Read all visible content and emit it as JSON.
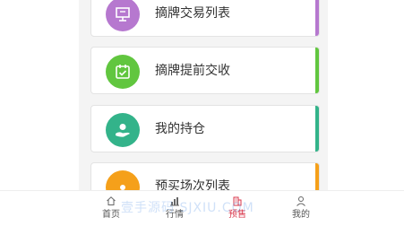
{
  "cards": [
    {
      "label": "摘牌交易列表",
      "icon": "presentation-board-icon",
      "color": "#b678cf",
      "stripe_color": "#b678cf"
    },
    {
      "label": "摘牌提前交收",
      "icon": "calendar-check-icon",
      "color": "#61c63f",
      "stripe_color": "#61c63f"
    },
    {
      "label": "我的持仓",
      "icon": "hand-coin-icon",
      "color": "#33b38a",
      "stripe_color": "#33b38a"
    },
    {
      "label": "预买场次列表",
      "icon": "list-icon",
      "color": "#f5a01a",
      "stripe_color": "#f5a01a"
    }
  ],
  "tabbar": {
    "tabs": [
      {
        "label": "首页",
        "icon": "home-icon",
        "active": false
      },
      {
        "label": "行情",
        "icon": "chart-icon",
        "active": false
      },
      {
        "label": "预售",
        "icon": "building-icon",
        "active": true
      },
      {
        "label": "我的",
        "icon": "user-icon",
        "active": false
      }
    ],
    "active_color": "#d9354a"
  },
  "watermark": "壹手源码 SJXIU.COM"
}
